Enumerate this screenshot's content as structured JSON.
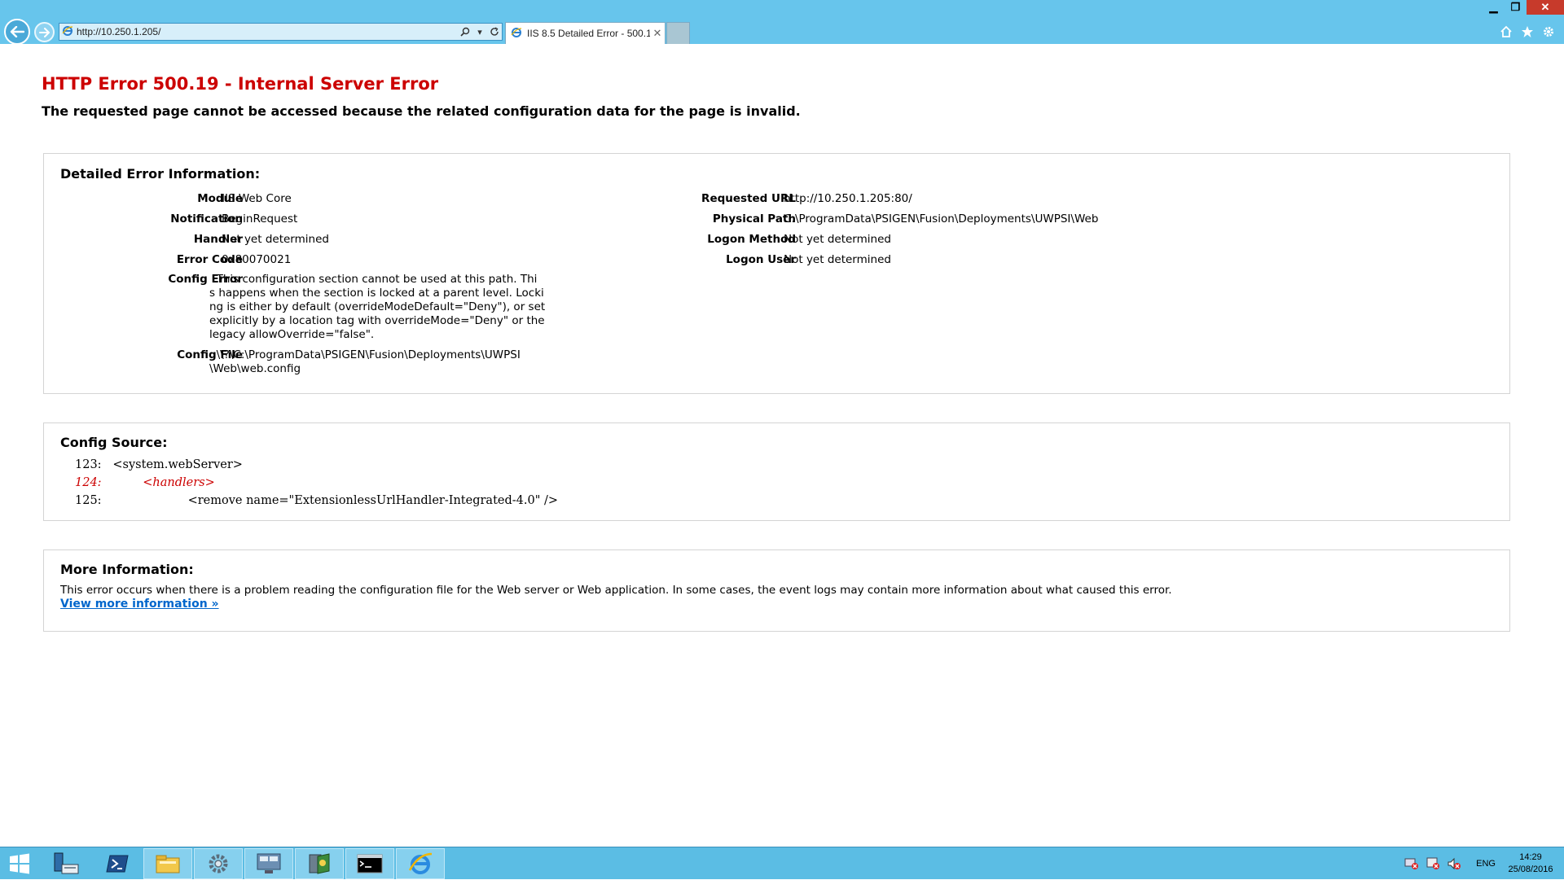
{
  "browser": {
    "url": "http://10.250.1.205/",
    "tab_title": "IIS 8.5 Detailed Error - 500.1...",
    "tab_close": "✕",
    "window_controls": {
      "minimize": "▁",
      "restore": "❐",
      "close": "✕"
    },
    "icons": [
      "back-arrow-icon",
      "forward-arrow-icon",
      "ie-logo-icon",
      "search-icon",
      "refresh-icon",
      "home-icon",
      "favorites-star-icon",
      "settings-gear-icon"
    ]
  },
  "error": {
    "title": "HTTP Error 500.19 - Internal Server Error",
    "subtitle": "The requested page cannot be accessed because the related configuration data for the page is invalid."
  },
  "detail": {
    "heading": "Detailed Error Information:",
    "left": [
      {
        "key": "Module",
        "value": "IIS Web Core"
      },
      {
        "key": "Notification",
        "value": "BeginRequest"
      },
      {
        "key": "Handler",
        "value": "Not yet determined"
      },
      {
        "key": "Error Code",
        "value": "0x80070021"
      },
      {
        "key": "Config Error",
        "value": "  This configuration section cannot be used at this path. Thi\ns happens when the section is locked at a parent level. Locki\nng is either by default (overrideModeDefault=\"Deny\"), or set\nexplicitly by a location tag with overrideMode=\"Deny\" or the\nlegacy allowOverride=\"false\"."
      },
      {
        "key": "Config File",
        "value": "  \\\\?\\C:\\ProgramData\\PSIGEN\\Fusion\\Deployments\\UWPSI\n\\Web\\web.config"
      }
    ],
    "right": [
      {
        "key": "Requested URL",
        "value": "http://10.250.1.205:80/"
      },
      {
        "key": "Physical Path",
        "value": "C:\\ProgramData\\PSIGEN\\Fusion\\Deployments\\UWPSI\\Web"
      },
      {
        "key": "Logon Method",
        "value": "Not yet determined"
      },
      {
        "key": "Logon User",
        "value": "Not yet determined"
      }
    ]
  },
  "source": {
    "heading": "Config Source:",
    "lines": [
      {
        "num": "123:",
        "code": "   <system.webServer>"
      },
      {
        "num": "124:",
        "code": "           <handlers>"
      },
      {
        "num": "125:",
        "code": "                       <remove name=\"ExtensionlessUrlHandler-Integrated-4.0\" />"
      }
    ]
  },
  "more": {
    "heading": "More Information:",
    "text": "This error occurs when there is a problem reading the configuration file for the Web server or Web application. In some cases, the event logs may contain more information about what caused this error.",
    "link": "View more information »"
  },
  "taskbar": {
    "buttons": [
      "windows-start-icon",
      "server-manager-icon",
      "powershell-icon",
      "file-explorer-icon",
      "control-panel-icon",
      "computer-management-icon",
      "iis-manager-icon",
      "command-prompt-icon",
      "internet-explorer-icon"
    ],
    "tray_lang": "ENG",
    "time": "14:29",
    "date": "25/08/2016"
  },
  "colors": {
    "chrome_bg": "#67c5ec",
    "taskbar_bg": "#5bbde4",
    "error_red": "#cc0000",
    "link_blue": "#0066cc",
    "panel_border": "#d4d4d4"
  }
}
